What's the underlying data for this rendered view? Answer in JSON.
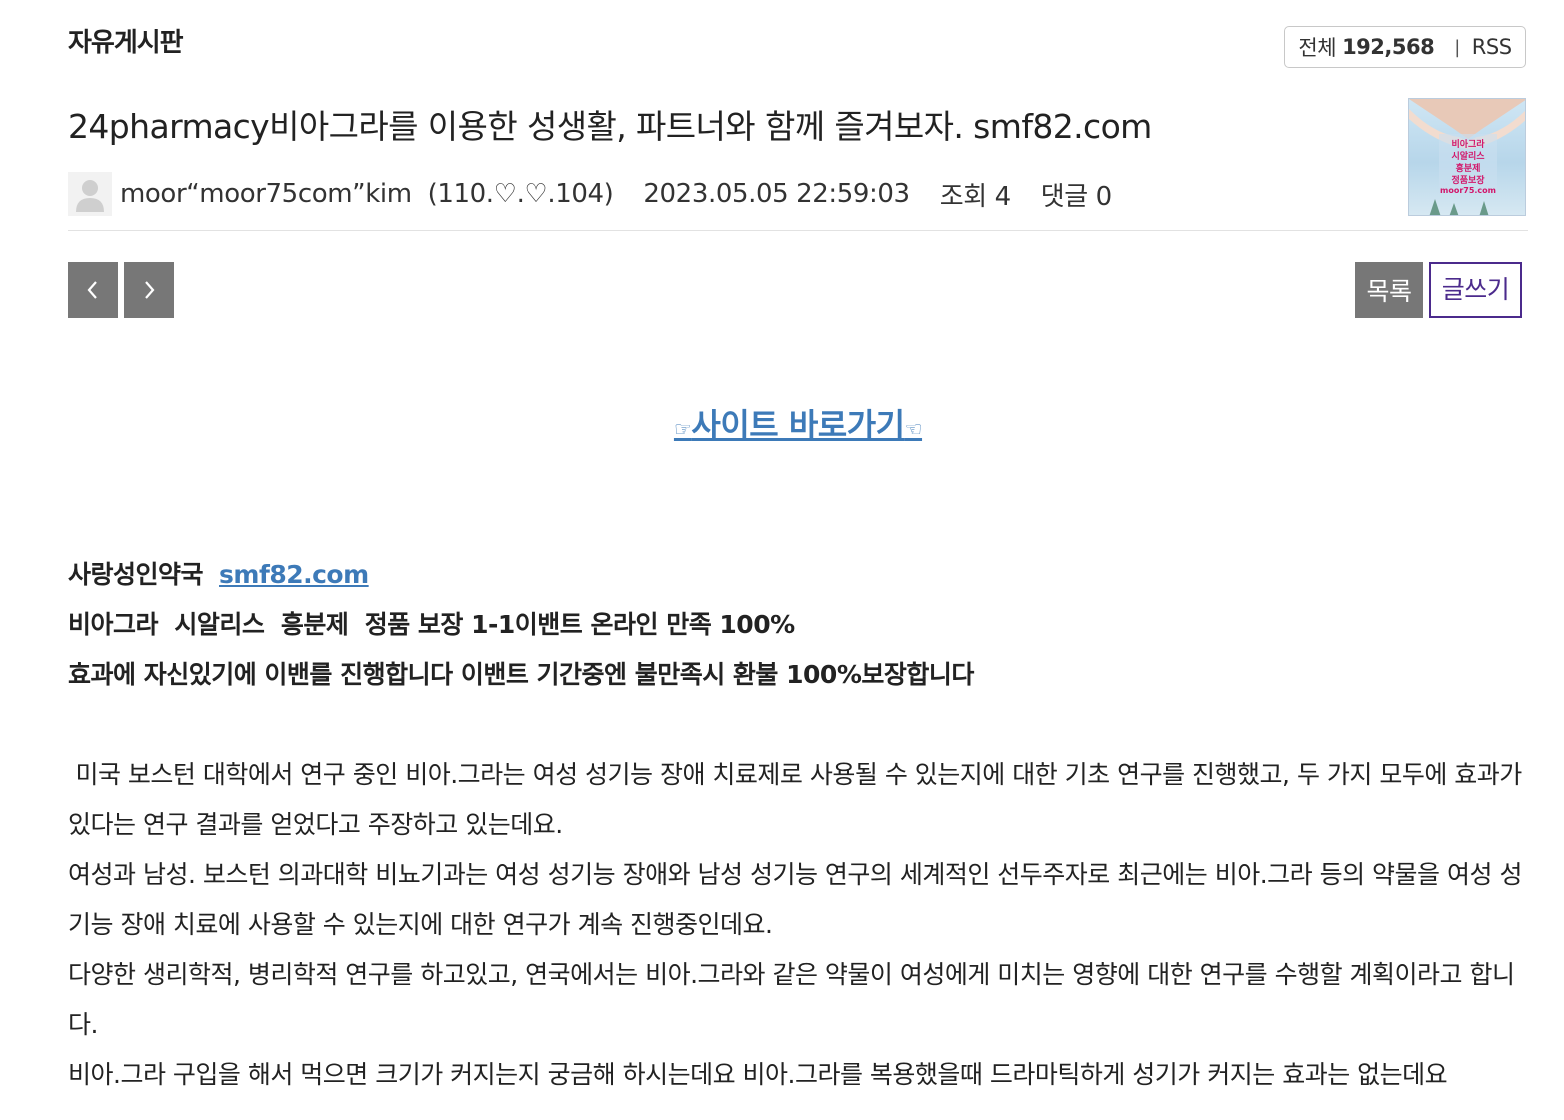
{
  "board": {
    "title": "자유게시판",
    "total_label": "전체",
    "total_count": "192,568",
    "rss_label": "RSS"
  },
  "post": {
    "title": "24pharmacy비아그라를 이용한 성생활, 파트너와 함께 즐겨보자. smf82.com",
    "author": "moor“moor75com”kim",
    "ip": "(110.♡.♡.104)",
    "datetime": "2023.05.05 22:59:03",
    "views": "조회 4",
    "comments": "댓글 0",
    "thumbnail_icon": "post-thumbnail-image"
  },
  "toolbar": {
    "prev_icon": "chevron-left-icon",
    "next_icon": "chevron-right-icon",
    "list_label": "목록",
    "write_label": "글쓰기"
  },
  "site_link": {
    "left_hand": "☞",
    "label": "사이트 바로가기",
    "right_hand": "☜"
  },
  "body": {
    "pharmacy_name": "사랑성인약국",
    "pharmacy_link": "smf82.com",
    "line2": "비아그라  시알리스  흥분제  정품 보장 1-1이밴트 온라인 만족 100%",
    "line3": "효과에 자신있기에 이밴를 진행합니다 이밴트 기간중엔 불만족시 환불 100%보장합니다",
    "para1": " 미국 보스턴 대학에서 연구 중인 비아.그라는 여성 성기능 장애 치료제로 사용될 수 있는지에 대한 기초 연구를 진행했고, 두 가지 모두에 효과가 있다는 연구 결과를 얻었다고 주장하고 있는데요.",
    "para2": "여성과 남성. 보스턴 의과대학 비뇨기과는 여성 성기능 장애와 남성 성기능 연구의 세계적인 선두주자로 최근에는 비아.그라 등의 약물을 여성 성기능 장애 치료에 사용할 수 있는지에 대한 연구가 계속 진행중인데요.",
    "para3": "다양한 생리학적, 병리학적 연구를 하고있고, 연국에서는 비아.그라와 같은 약물이 여성에게 미치는 영향에 대한 연구를 수행할 계획이라고 합니다.",
    "para4": "비아.그라 구입을 해서 먹으면 크기가 커지는지 궁금해 하시는데요 비아.그라를 복용했을때 드라마틱하게 성기가 커지는 효과는 없는데요"
  },
  "colors": {
    "accent_link": "#3d7ab8",
    "write_button": "#4b2a8c",
    "gray_button": "#777777"
  }
}
